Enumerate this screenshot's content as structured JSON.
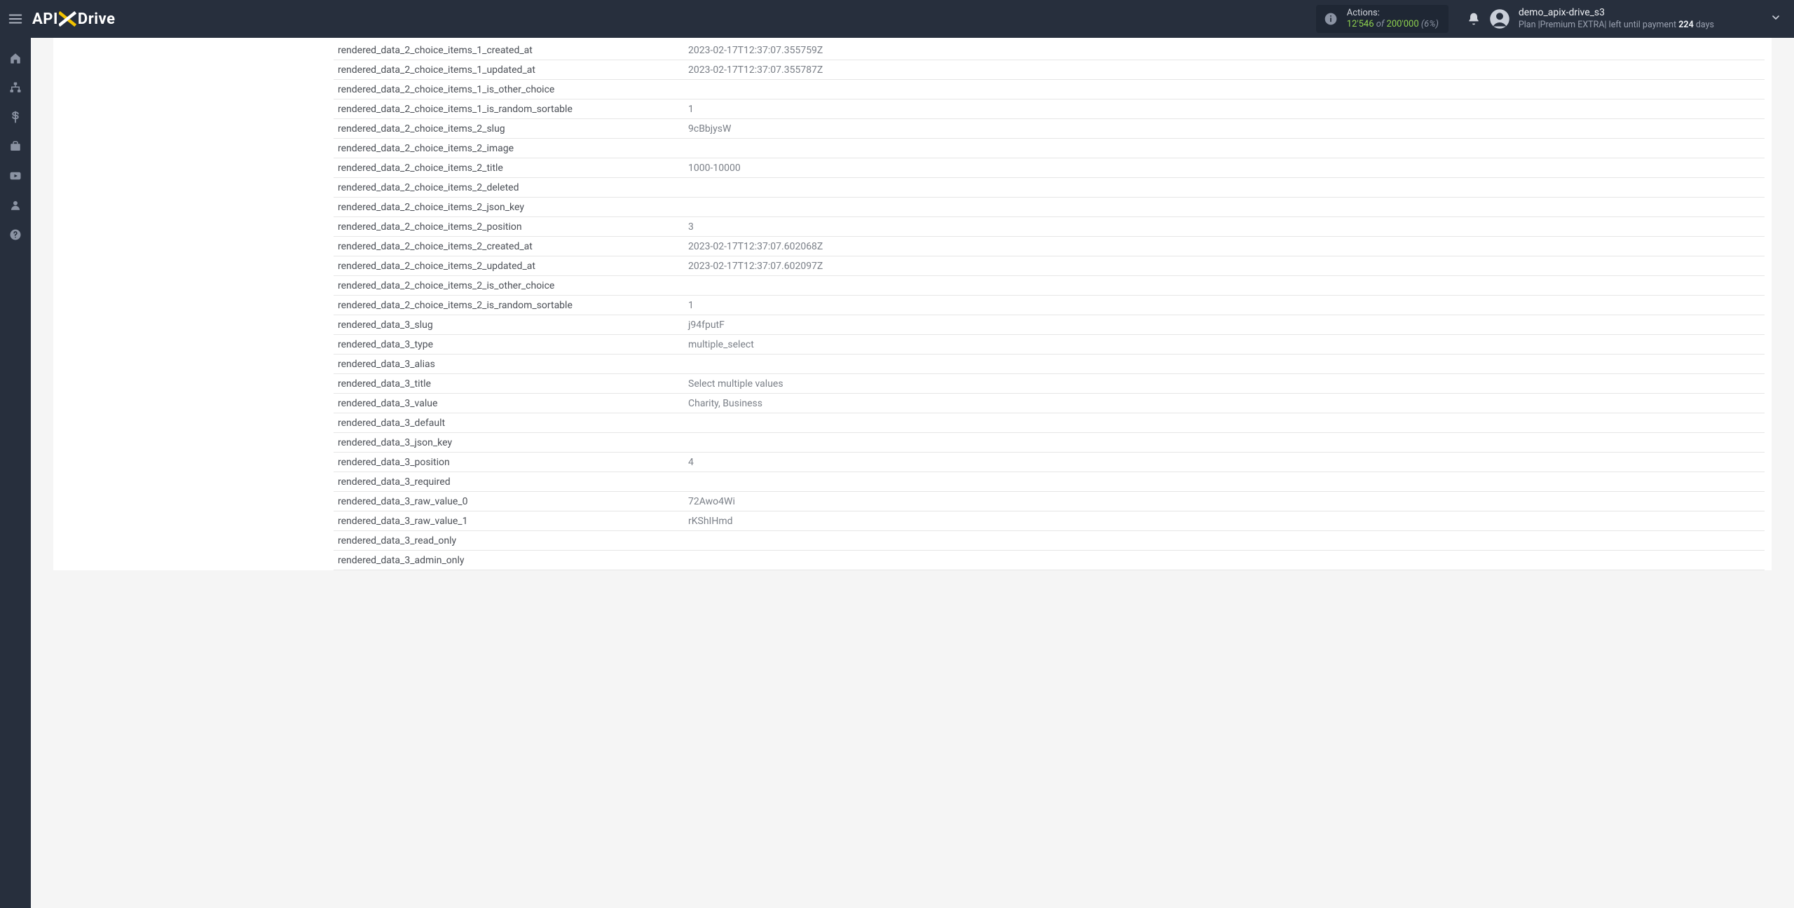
{
  "header": {
    "logo_api": "API",
    "logo_drive": "Drive",
    "actions_label": "Actions:",
    "actions_used": "12'546",
    "actions_of": " of ",
    "actions_total": "200'000",
    "actions_pct": " (6%)",
    "account_name": "demo_apix-drive_s3",
    "plan_prefix": "Plan |",
    "plan_name": "Premium EXTRA",
    "plan_middle": "| left until payment ",
    "plan_days_num": "224",
    "plan_days_suffix": " days"
  },
  "rows": [
    {
      "key": "rendered_data_2_choice_items_1_created_at",
      "val": "2023-02-17T12:37:07.355759Z"
    },
    {
      "key": "rendered_data_2_choice_items_1_updated_at",
      "val": "2023-02-17T12:37:07.355787Z"
    },
    {
      "key": "rendered_data_2_choice_items_1_is_other_choice",
      "val": ""
    },
    {
      "key": "rendered_data_2_choice_items_1_is_random_sortable",
      "val": "1"
    },
    {
      "key": "rendered_data_2_choice_items_2_slug",
      "val": "9cBbjysW"
    },
    {
      "key": "rendered_data_2_choice_items_2_image",
      "val": ""
    },
    {
      "key": "rendered_data_2_choice_items_2_title",
      "val": "1000-10000"
    },
    {
      "key": "rendered_data_2_choice_items_2_deleted",
      "val": ""
    },
    {
      "key": "rendered_data_2_choice_items_2_json_key",
      "val": ""
    },
    {
      "key": "rendered_data_2_choice_items_2_position",
      "val": "3"
    },
    {
      "key": "rendered_data_2_choice_items_2_created_at",
      "val": "2023-02-17T12:37:07.602068Z"
    },
    {
      "key": "rendered_data_2_choice_items_2_updated_at",
      "val": "2023-02-17T12:37:07.602097Z"
    },
    {
      "key": "rendered_data_2_choice_items_2_is_other_choice",
      "val": ""
    },
    {
      "key": "rendered_data_2_choice_items_2_is_random_sortable",
      "val": "1"
    },
    {
      "key": "rendered_data_3_slug",
      "val": "j94fputF"
    },
    {
      "key": "rendered_data_3_type",
      "val": "multiple_select"
    },
    {
      "key": "rendered_data_3_alias",
      "val": ""
    },
    {
      "key": "rendered_data_3_title",
      "val": "Select multiple values"
    },
    {
      "key": "rendered_data_3_value",
      "val": "Charity, Business"
    },
    {
      "key": "rendered_data_3_default",
      "val": ""
    },
    {
      "key": "rendered_data_3_json_key",
      "val": ""
    },
    {
      "key": "rendered_data_3_position",
      "val": "4"
    },
    {
      "key": "rendered_data_3_required",
      "val": ""
    },
    {
      "key": "rendered_data_3_raw_value_0",
      "val": "72Awo4Wi"
    },
    {
      "key": "rendered_data_3_raw_value_1",
      "val": "rKShIHmd"
    },
    {
      "key": "rendered_data_3_read_only",
      "val": ""
    },
    {
      "key": "rendered_data_3_admin_only",
      "val": ""
    }
  ]
}
